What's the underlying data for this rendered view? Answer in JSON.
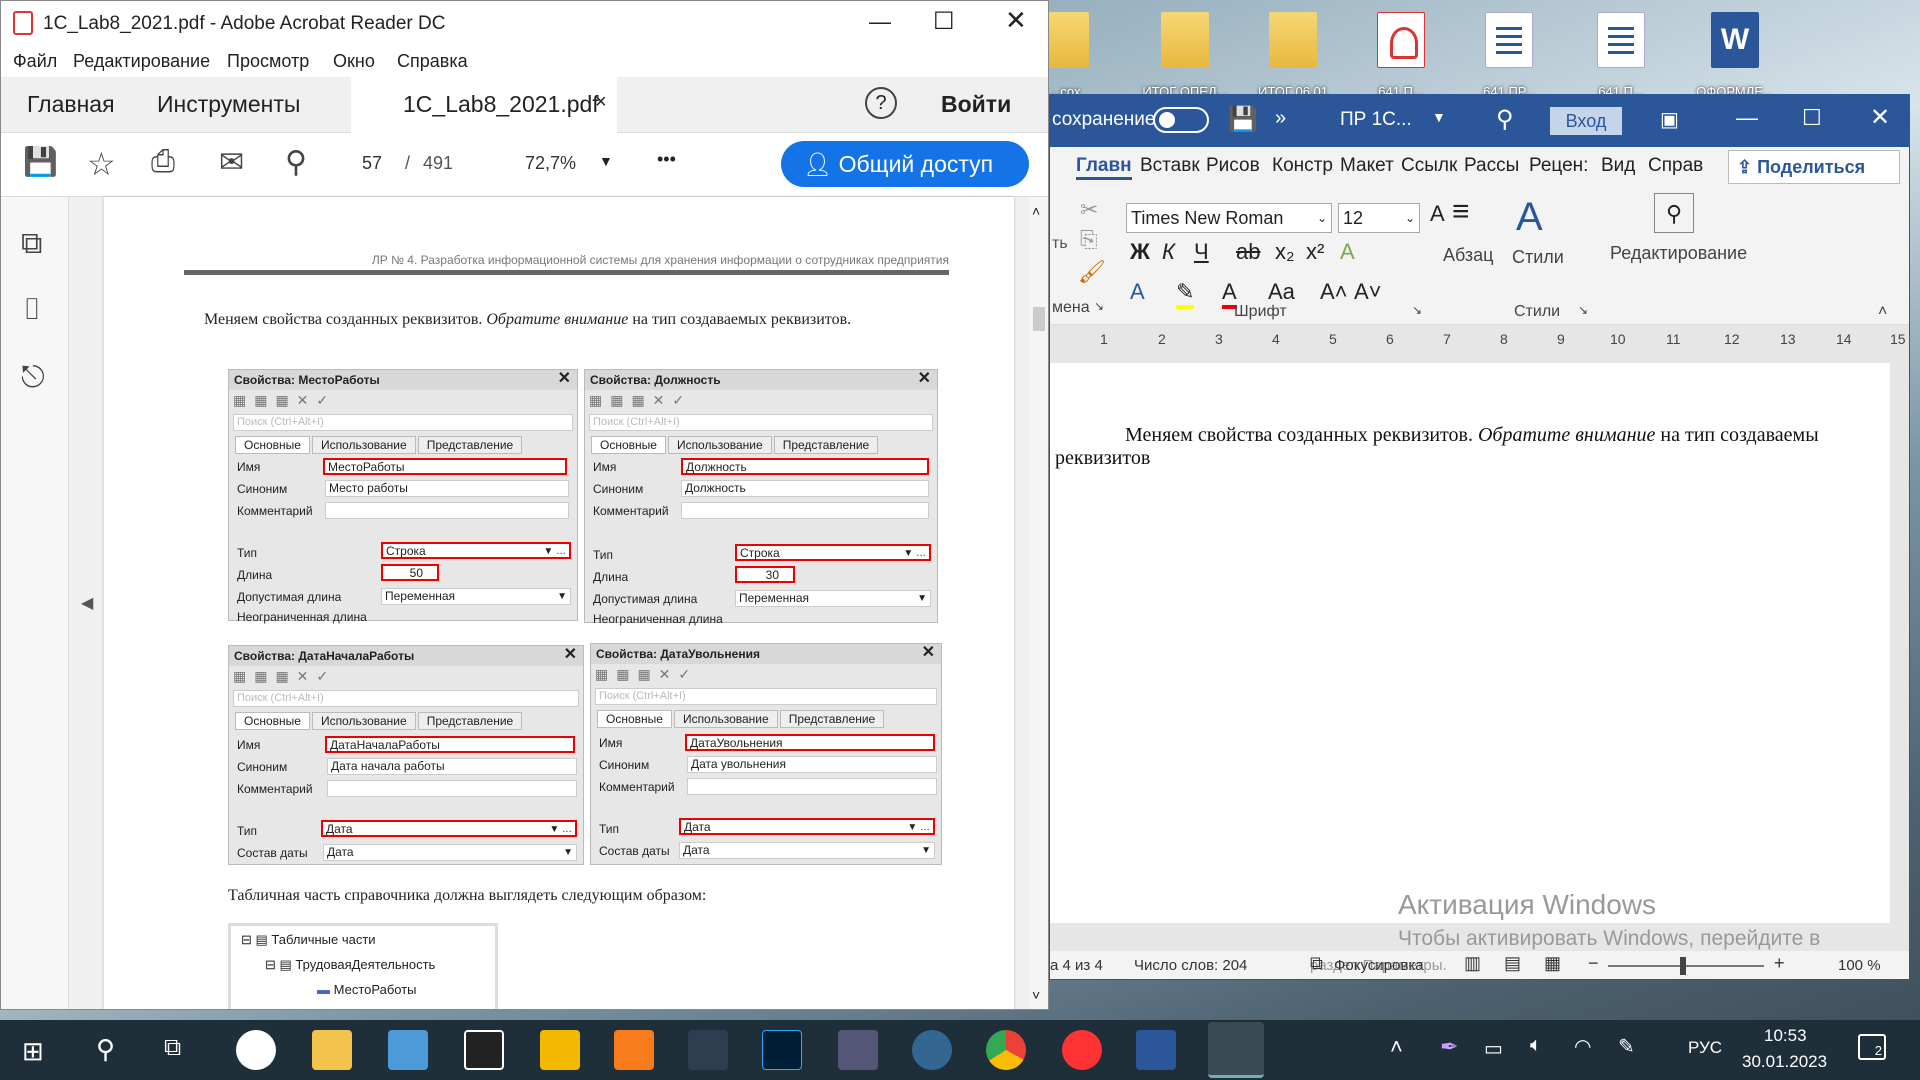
{
  "desktop": {
    "icons": [
      {
        "label": "...сох",
        "kind": "folder"
      },
      {
        "label": "ИТОГ ОПЕД...",
        "kind": "folder"
      },
      {
        "label": "ИТОГ 06.01",
        "kind": "folder"
      },
      {
        "label": "641 П...",
        "kind": "pdf"
      },
      {
        "label": "641 ПР...",
        "kind": "word"
      },
      {
        "label": "641 П...",
        "kind": "word"
      },
      {
        "label": "ОФОРМЛЕ...",
        "kind": "wordapp"
      }
    ],
    "word_app_letter": "W"
  },
  "acrobat": {
    "title": "1C_Lab8_2021.pdf - Adobe Acrobat Reader DC",
    "menu": [
      "Файл",
      "Редактирование",
      "Просмотр",
      "Окно",
      "Справка"
    ],
    "tabs": {
      "home": "Главная",
      "tools": "Инструменты",
      "doc": "1C_Lab8_2021.pdf",
      "close": "×",
      "help": "?",
      "signin": "Войти"
    },
    "toolbar": {
      "page": "57",
      "sep": "/",
      "total": "491",
      "zoom": "72,7%",
      "more": "•••",
      "share": "Общий доступ"
    },
    "pdf": {
      "header": "ЛР № 4. Разработка информационной системы для хранения информации о сотрудниках предприятия",
      "para1_a": "Меняем свойства созданных реквизитов.",
      "para1_b": "Обратите внимание",
      "para1_c": "на тип создаваемых реквизитов.",
      "para2": "Табличная часть справочника должна выглядеть следующим образом:",
      "search_placeholder": "Поиск (Ctrl+Alt+I)",
      "tab_main": "Основные",
      "tab_use": "Использование",
      "tab_view": "Представление",
      "lbl_name": "Имя",
      "lbl_syn": "Синоним",
      "lbl_comment": "Комментарий",
      "lbl_type": "Тип",
      "lbl_len": "Длина",
      "lbl_alen": "Допустимая длина",
      "lbl_unlim": "Неограниченная длина",
      "lbl_datecomp": "Состав даты",
      "panels": [
        {
          "title": "Свойства: МестоРаботы",
          "name": "МестоРаботы",
          "syn": "Место работы",
          "type": "Строка",
          "len": "50",
          "alen": "Переменная"
        },
        {
          "title": "Свойства: Должность",
          "name": "Должность",
          "syn": "Должность",
          "type": "Строка",
          "len": "30",
          "alen": "Переменная"
        },
        {
          "title": "Свойства: ДатаНачалаРаботы",
          "name": "ДатаНачалаРаботы",
          "syn": "Дата начала работы",
          "type": "Дата",
          "datecomp": "Дата"
        },
        {
          "title": "Свойства: ДатаУвольнения",
          "name": "ДатаУвольнения",
          "syn": "Дата увольнения",
          "type": "Дата",
          "datecomp": "Дата"
        }
      ],
      "tree": [
        "Табличные части",
        "ТрудоваяДеятельность",
        "МестоРаботы"
      ]
    }
  },
  "word": {
    "autosave": "сохранение",
    "doctitle": "ПР 1С...",
    "signin": "Вход",
    "tabs": [
      "Главн",
      "Вставк",
      "Рисов",
      "Констр",
      "Макет",
      "Ссылк",
      "Рассы",
      "Рецен:",
      "Вид",
      "Справ"
    ],
    "share": "Поделиться",
    "font": "Times New Roman",
    "size": "12",
    "grp_font": "Шрифт",
    "grp_styles": "Стили",
    "grp_clip": "мена",
    "clip_partial": "ть",
    "para": "Абзац",
    "styles": "Стили",
    "edit": "Редактирование",
    "ruler": [
      "1",
      "2",
      "3",
      "4",
      "5",
      "6",
      "7",
      "8",
      "9",
      "10",
      "11",
      "12",
      "13",
      "14",
      "15"
    ],
    "body_a": "Меняем свойства созданных реквизитов.",
    "body_b": "Обратите внимание",
    "body_c": "на тип создаваемы",
    "body_d": "реквизитов",
    "activation_title": "Активация Windows",
    "activation_sub": "Чтобы активировать Windows, перейдите в",
    "activation_sub2": "раздел Параметры.",
    "status_page": "а 4 из 4",
    "status_words": "Число слов: 204",
    "status_focus": "Фокусировка",
    "zoom": "100 %"
  },
  "taskbar": {
    "lang": "РУС",
    "time": "10:53",
    "date": "30.01.2023",
    "notif": "2"
  }
}
